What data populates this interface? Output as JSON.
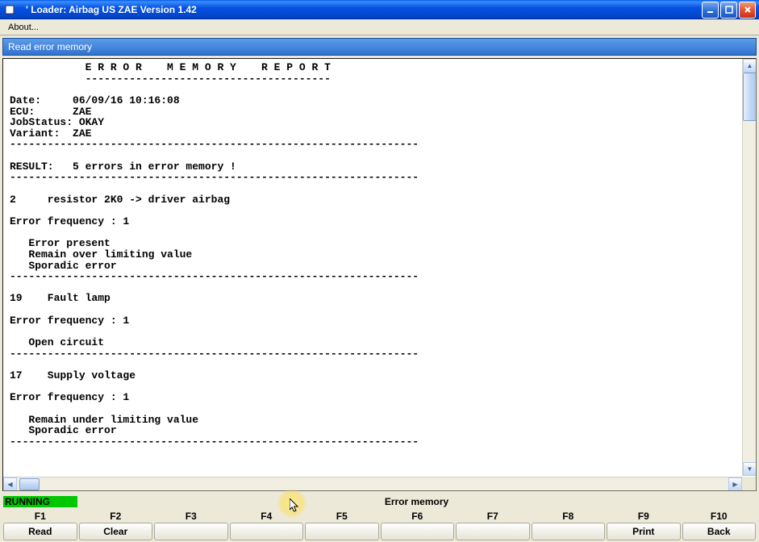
{
  "titlebar": {
    "title": "'  Loader:   Airbag US ZAE Version 1.42"
  },
  "menubar": {
    "about": "About..."
  },
  "panel": {
    "header": "Read error memory"
  },
  "report": {
    "text": "            E R R O R    M E M O R Y    R E P O R T\n            ---------------------------------------\n\nDate:     06/09/16 10:16:08\nECU:      ZAE\nJobStatus: OKAY\nVariant:  ZAE\n-----------------------------------------------------------------\n\nRESULT:   5 errors in error memory !\n-----------------------------------------------------------------\n\n2     resistor 2K0 -> driver airbag\n\nError frequency : 1\n\n   Error present\n   Remain over limiting value\n   Sporadic error\n-----------------------------------------------------------------\n\n19    Fault lamp\n\nError frequency : 1\n\n   Open circuit\n-----------------------------------------------------------------\n\n17    Supply voltage\n\nError frequency : 1\n\n   Remain under limiting value\n   Sporadic error\n-----------------------------------------------------------------\n"
  },
  "status": {
    "running": "RUNNING",
    "center": "Error memory"
  },
  "fkeys": {
    "labels": [
      "F1",
      "F2",
      "F3",
      "F4",
      "F5",
      "F6",
      "F7",
      "F8",
      "F9",
      "F10"
    ],
    "buttons": [
      "Read",
      "Clear",
      "",
      "",
      "",
      "",
      "",
      "",
      "Print",
      "Back"
    ]
  }
}
